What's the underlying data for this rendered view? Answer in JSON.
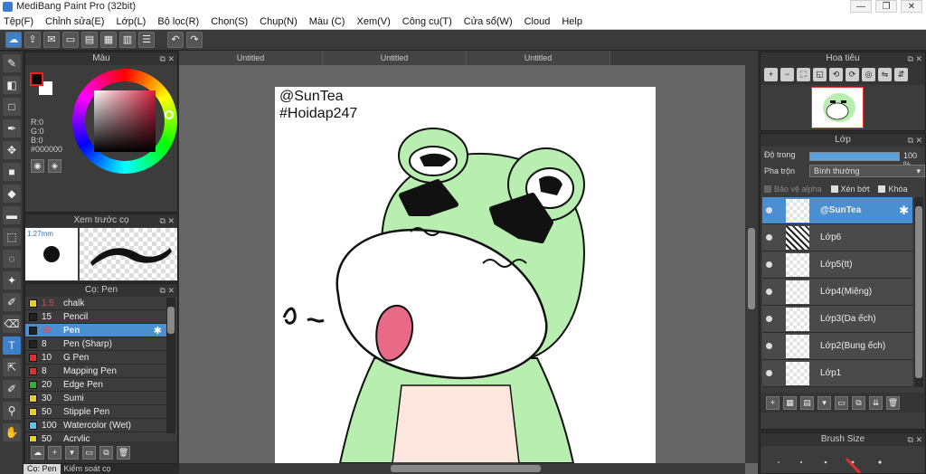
{
  "window": {
    "title": "MediBang Paint Pro (32bit)",
    "minimize": "—",
    "maximize": "❐",
    "close": "✕"
  },
  "menu": [
    "Tệp(F)",
    "Chỉnh sửa(E)",
    "Lớp(L)",
    "Bộ lọc(R)",
    "Chọn(S)",
    "Chụp(N)",
    "Màu (C)",
    "Xem(V)",
    "Công cụ(T)",
    "Cửa sổ(W)",
    "Cloud",
    "Help"
  ],
  "color_panel": {
    "title": "Màu",
    "rgb": "R:0 G:0 B:0",
    "r": "R:0",
    "g": "G:0",
    "b": "B:0",
    "hex": "#000000",
    "accent": "#d21c3c"
  },
  "brush_preview": {
    "title": "Xem trước cọ",
    "size": "1.27mm"
  },
  "brush_panel": {
    "title": "Cọ: Pen",
    "items": [
      {
        "size": "1.5",
        "name": "chalk",
        "color": "#e8d020"
      },
      {
        "size": "15",
        "name": "Pencil",
        "color": "#222222"
      },
      {
        "size": "30",
        "name": "Pen",
        "color": "#222222"
      },
      {
        "size": "8",
        "name": "Pen (Sharp)",
        "color": "#222222"
      },
      {
        "size": "10",
        "name": "G Pen",
        "color": "#e03030"
      },
      {
        "size": "8",
        "name": "Mapping Pen",
        "color": "#e03030"
      },
      {
        "size": "20",
        "name": "Edge Pen",
        "color": "#30b030"
      },
      {
        "size": "30",
        "name": "Sumi",
        "color": "#e8d020"
      },
      {
        "size": "50",
        "name": "Stipple Pen",
        "color": "#e8d020"
      },
      {
        "size": "100",
        "name": "Watercolor (Wet)",
        "color": "#60c0f0"
      },
      {
        "size": "50",
        "name": "Acrylic",
        "color": "#e8d020"
      }
    ],
    "selected_gear": "✱"
  },
  "bottom_tabs": [
    "Cọ: Pen",
    "Kiểm soát cọ"
  ],
  "doc_tabs": [
    "Untitled",
    "Untitled",
    "Untitled"
  ],
  "canvas_text": {
    "line1": "@SunTea",
    "line2": "#Hoidap247"
  },
  "navigator": {
    "title": "Hoa tiêu"
  },
  "layer_panel": {
    "title": "Lớp",
    "opacity_label": "Độ trong",
    "opacity_value": "100 %",
    "blend_label": "Pha trộn",
    "blend_value": "Bình thường",
    "protect_alpha": "Bảo vệ alpha",
    "clipping": "Xén bớt",
    "lock": "Khóa",
    "layers": [
      "@SunTea",
      "Lớp6",
      "Lớp5(tt)",
      "Lớp4(Miệng)",
      "Lớp3(Da ếch)",
      "Lớp2(Bung ếch)",
      "Lớp1"
    ]
  },
  "brush_size": {
    "title": "Brush Size"
  }
}
